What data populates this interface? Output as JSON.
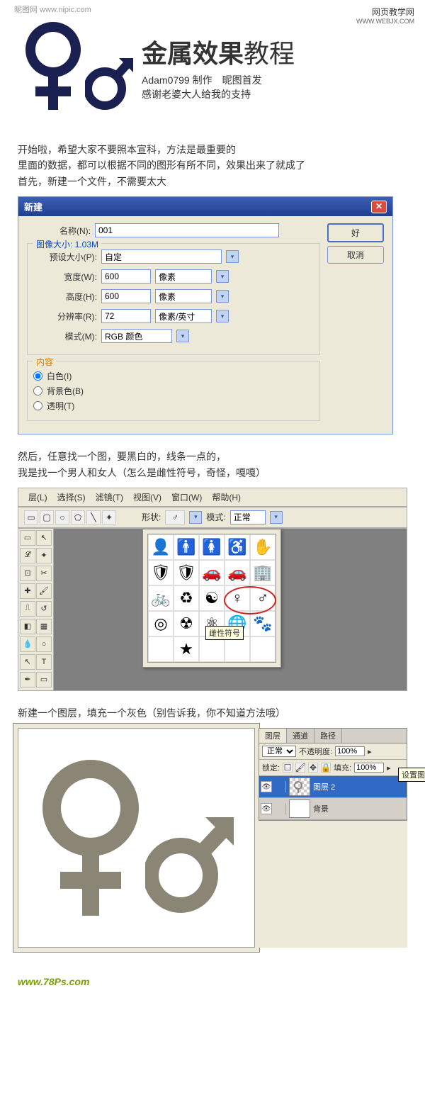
{
  "watermarks": {
    "topleft": "昵图网 www.nipic.com",
    "topright": "网页教学网",
    "topright_sub": "WWW.WEBJX.COM"
  },
  "hero": {
    "title_bold": "金属效果",
    "title_light": "教程",
    "sub1": "Adam0799 制作　昵图首发",
    "sub2": "感谢老婆大人给我的支持"
  },
  "step1": {
    "line1": "开始啦，希望大家不要照本宣科，方法是最重要的",
    "line2": "里面的数据，都可以根据不同的图形有所不同，效果出来了就成了",
    "line3": "首先，新建一个文件，不需要太大"
  },
  "dialog": {
    "title": "新建",
    "name_label": "名称(N):",
    "name_value": "001",
    "ok": "好",
    "cancel": "取消",
    "size_legend": "图像大小: 1.03M",
    "preset_label": "预设大小(P):",
    "preset_value": "自定",
    "width_label": "宽度(W):",
    "width_value": "600",
    "width_unit": "像素",
    "height_label": "高度(H):",
    "height_value": "600",
    "height_unit": "像素",
    "resolution_label": "分辨率(R):",
    "resolution_value": "72",
    "resolution_unit": "像素/英寸",
    "mode_label": "模式(M):",
    "mode_value": "RGB 颜色",
    "content_legend": "内容",
    "content_white": "白色(I)",
    "content_bg": "背景色(B)",
    "content_transparent": "透明(T)"
  },
  "step2": {
    "line1": "然后，任意找一个图，要黑白的，线条一点的，",
    "line2": "我是找一个男人和女人（怎么是雌性符号，奇怪，嘎嘎）"
  },
  "menubar": {
    "items": [
      "层(L)",
      "选择(S)",
      "滤镜(T)",
      "视图(V)",
      "窗口(W)",
      "帮助(H)"
    ]
  },
  "optionbar": {
    "shape_label": "形状:",
    "mode_label": "模式:",
    "mode_value": "正常"
  },
  "shapes": {
    "tooltip": "雌性符号",
    "grid": [
      "👤",
      "🚹",
      "🚺",
      "♿",
      "✋",
      "🛡",
      "🛡",
      "🚗",
      "🚗",
      "🏢",
      "🚲",
      "🔄",
      "☯",
      "♀",
      "♂",
      "◎",
      "☢",
      "⚛",
      "🌐",
      "🐾",
      "",
      "★"
    ]
  },
  "step3": {
    "text": "新建一个图层，填充一个灰色（别告诉我，你不知道方法哦）"
  },
  "layers": {
    "tabs": [
      "图层",
      "通道",
      "路径"
    ],
    "blend_mode": "正常",
    "opacity_label": "不透明度:",
    "opacity_value": "100%",
    "lock_label": "锁定:",
    "fill_label": "填充:",
    "fill_value": "100%",
    "tooltip": "设置图",
    "items": [
      {
        "name": "图层 2",
        "selected": true
      },
      {
        "name": "背景",
        "selected": false
      }
    ]
  },
  "footer": "www.78Ps.com",
  "symbol_color_gray": "#8a8575"
}
